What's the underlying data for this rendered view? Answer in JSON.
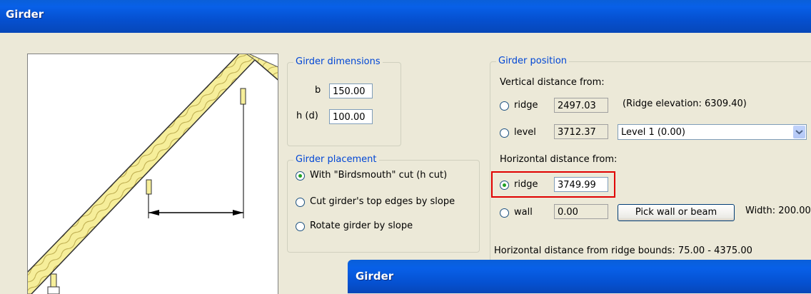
{
  "window": {
    "title": "Girder"
  },
  "dimensions": {
    "legend": "Girder dimensions",
    "b_label": "b",
    "b_value": "150.00",
    "h_label": "h (d)",
    "h_value": "100.00"
  },
  "placement": {
    "legend": "Girder placement",
    "options": [
      {
        "label": "With \"Birdsmouth\" cut (h cut)",
        "selected": true
      },
      {
        "label": "Cut girder's top edges by slope",
        "selected": false
      },
      {
        "label": "Rotate girder by slope",
        "selected": false
      }
    ]
  },
  "position": {
    "legend": "Girder position",
    "vertical_label": "Vertical distance from:",
    "ridge_label": "ridge",
    "ridge_value": "2497.03",
    "ridge_elevation": "(Ridge elevation: 6309.40)",
    "level_label": "level",
    "level_value": "3712.37",
    "level_select": "Level 1 (0.00)",
    "horizontal_label": "Horizontal distance from:",
    "h_ridge_label": "ridge",
    "h_ridge_value": "3749.99",
    "wall_label": "wall",
    "wall_value": "0.00",
    "pick_button": "Pick wall or beam",
    "width_text": "Width: 200.00",
    "bounds_text": "Horizontal distance from ridge bounds: 75.00 - 4375.00"
  },
  "sub_window": {
    "title": "Girder"
  },
  "colors": {
    "titlebar": "#0550d0",
    "highlight": "#e00000",
    "legend_text": "#0046d5"
  }
}
